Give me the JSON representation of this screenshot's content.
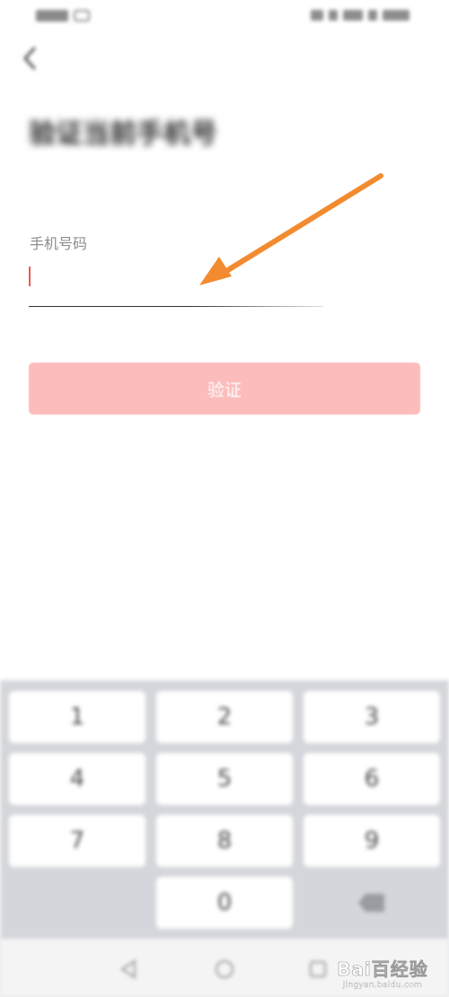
{
  "status_bar": {
    "left": "",
    "right": ""
  },
  "page": {
    "title": "验证当前手机号",
    "subtitle": "",
    "phone_label": "手机号码",
    "phone_value": "",
    "phone_placeholder": "",
    "verify_label": "验证"
  },
  "keyboard": {
    "keys": [
      "1",
      "2",
      "3",
      "4",
      "5",
      "6",
      "7",
      "8",
      "9",
      "0"
    ],
    "delete_icon": "backspace-icon"
  },
  "nav": {
    "back_icon": "triangle-back-icon",
    "home_icon": "circle-home-icon",
    "recent_icon": "square-recent-icon"
  },
  "annotation": {
    "arrow_color": "#f28b30"
  },
  "watermark": {
    "brand": "Bai百经验",
    "url": "jingyan.baidu.com"
  },
  "colors": {
    "accent": "#e85c52",
    "button": "#fcbcbc",
    "keyboard_bg": "#d4d6db"
  }
}
